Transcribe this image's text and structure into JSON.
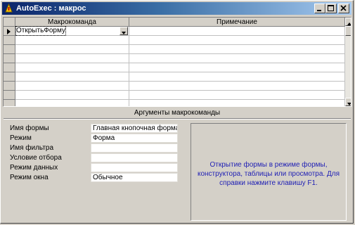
{
  "window": {
    "title": "AutoExec : макрос",
    "controls": [
      "minimize-icon",
      "maximize-icon",
      "close-icon"
    ]
  },
  "grid": {
    "columns": [
      "Макрокоманда",
      "Примечание"
    ],
    "rows": [
      {
        "action": "ОткрытьФорму",
        "note": "",
        "current": true
      },
      {
        "action": "",
        "note": ""
      },
      {
        "action": "",
        "note": ""
      },
      {
        "action": "",
        "note": ""
      },
      {
        "action": "",
        "note": ""
      },
      {
        "action": "",
        "note": ""
      },
      {
        "action": "",
        "note": ""
      },
      {
        "action": "",
        "note": ""
      },
      {
        "action": "",
        "note": ""
      }
    ]
  },
  "arguments": {
    "caption": "Аргументы макрокоманды",
    "fields": [
      {
        "label": "Имя формы",
        "value": "Главная кнопочная форма"
      },
      {
        "label": "Режим",
        "value": "Форма"
      },
      {
        "label": "Имя фильтра",
        "value": ""
      },
      {
        "label": "Условие отбора",
        "value": ""
      },
      {
        "label": "Режим данных",
        "value": ""
      },
      {
        "label": "Режим окна",
        "value": "Обычное"
      }
    ],
    "hint": "Открытие формы в режиме формы, конструктора, таблицы или просмотра. Для справки нажмите клавишу F1.",
    "hint_color": "#1f1fb4"
  },
  "colors": {
    "titlebar_start": "#0a246a",
    "titlebar_end": "#a6caf0",
    "face": "#d4d0c8"
  }
}
